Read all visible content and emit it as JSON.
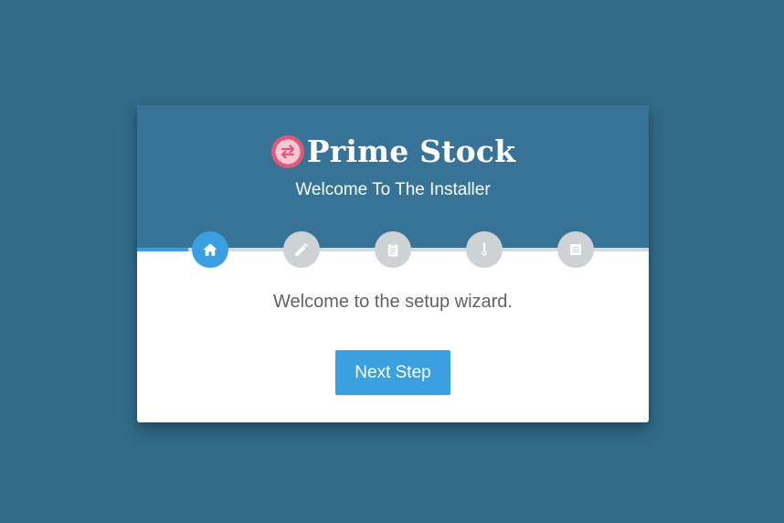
{
  "colors": {
    "page_background": "#316b8a",
    "header_background": "#367397",
    "accent": "#3a9ee0",
    "inactive_step": "#cdd2d5",
    "logo": "#e2577a"
  },
  "brand": {
    "name": "Prime Stock",
    "logo_icon": "exchange-arrows-icon"
  },
  "header": {
    "subtitle": "Welcome To The Installer"
  },
  "wizard": {
    "progress": 0.1,
    "current_step": 1,
    "steps": [
      {
        "icon": "home-icon",
        "active": true
      },
      {
        "icon": "pencil-icon",
        "active": false
      },
      {
        "icon": "clipboard-icon",
        "active": false
      },
      {
        "icon": "thermometer-icon",
        "active": false
      },
      {
        "icon": "document-list-icon",
        "active": false
      }
    ]
  },
  "body": {
    "message": "Welcome to the setup wizard.",
    "next_button_label": "Next Step"
  }
}
